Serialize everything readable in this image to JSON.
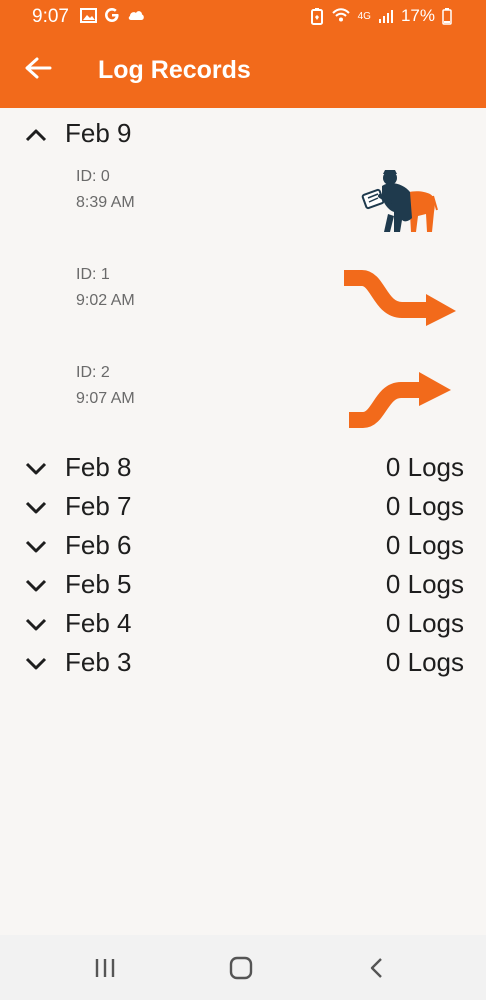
{
  "status_bar": {
    "time": "9:07",
    "network": "4G",
    "battery": "17%",
    "icons_left": [
      "image-icon",
      "google-icon",
      "cloud-icon"
    ],
    "icons_right": [
      "battery-saver-icon",
      "wifi-calling-icon",
      "signal-icon",
      "battery-icon"
    ]
  },
  "app_bar": {
    "title": "Log Records",
    "back_icon": "arrow-left-icon"
  },
  "colors": {
    "accent": "#f26a1b",
    "text_primary": "#1e1e1e",
    "text_secondary": "#6a6a6a",
    "background": "#f8f6f4",
    "navy": "#1f3a4d"
  },
  "groups": [
    {
      "date": "Feb 9",
      "expanded": true,
      "count": "",
      "records": [
        {
          "id": "ID: 0",
          "time": "8:39 AM",
          "icon": "farmer-inspecting-cow-icon"
        },
        {
          "id": "ID: 1",
          "time": "9:02 AM",
          "icon": "curved-arrow-right-down-icon"
        },
        {
          "id": "ID: 2",
          "time": "9:07 AM",
          "icon": "curved-arrow-right-up-icon"
        }
      ]
    },
    {
      "date": "Feb 8",
      "expanded": false,
      "count": "0 Logs"
    },
    {
      "date": "Feb 7",
      "expanded": false,
      "count": "0 Logs"
    },
    {
      "date": "Feb 6",
      "expanded": false,
      "count": "0 Logs"
    },
    {
      "date": "Feb 5",
      "expanded": false,
      "count": "0 Logs"
    },
    {
      "date": "Feb 4",
      "expanded": false,
      "count": "0 Logs"
    },
    {
      "date": "Feb 3",
      "expanded": false,
      "count": "0 Logs"
    }
  ],
  "nav_bar": {
    "buttons": [
      "recent-apps-icon",
      "home-icon",
      "back-icon"
    ]
  }
}
